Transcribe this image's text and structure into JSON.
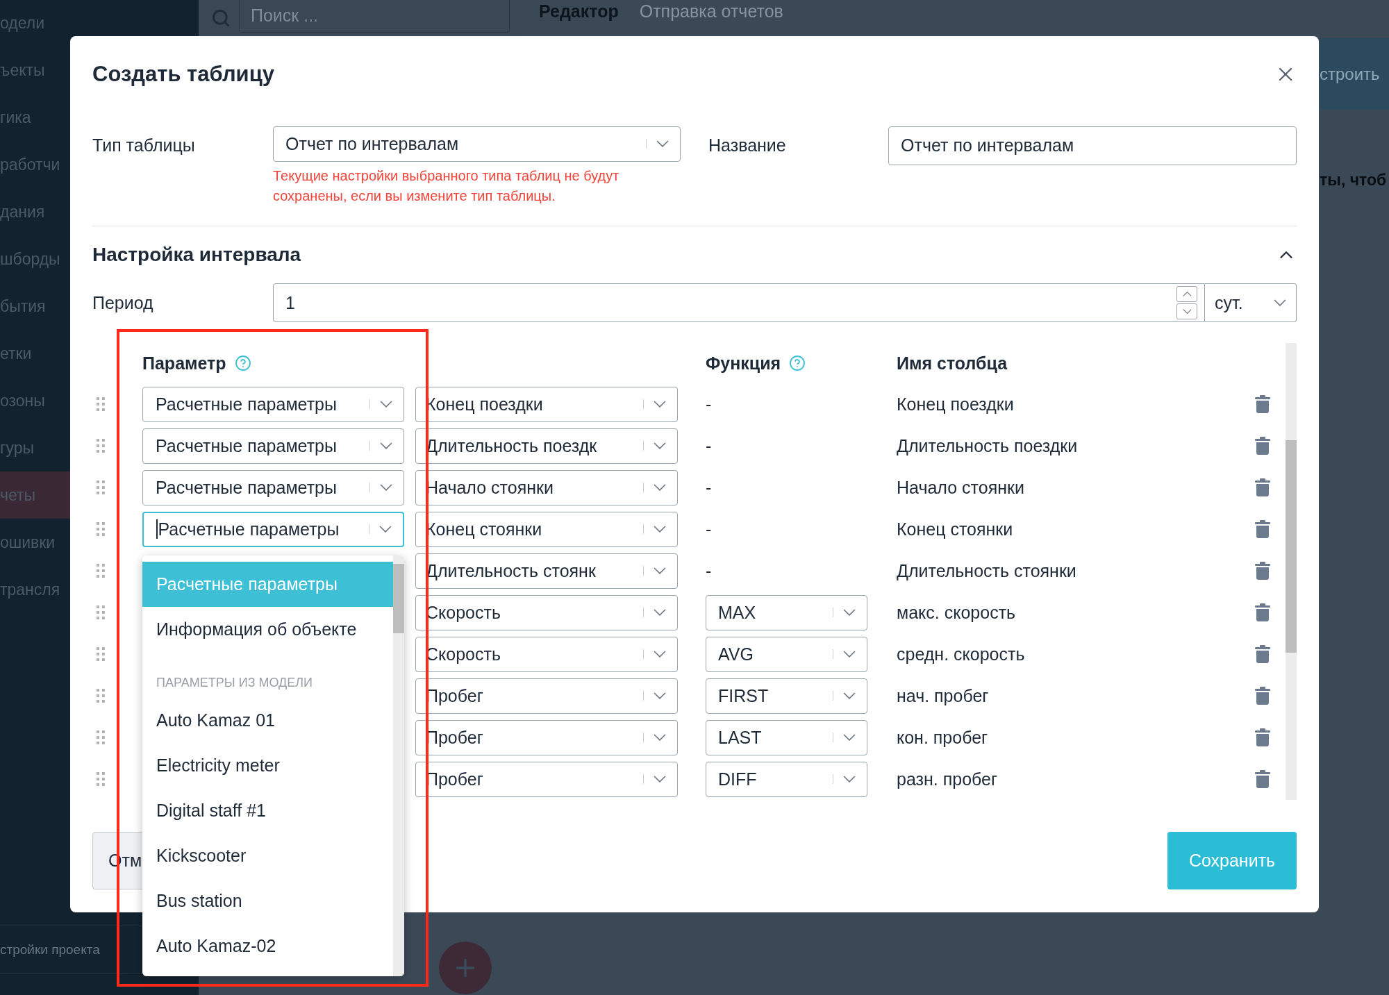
{
  "background": {
    "sidebar": {
      "items": [
        {
          "label": "одели",
          "selected": false
        },
        {
          "label": "ъекты",
          "selected": false
        },
        {
          "label": "гика",
          "selected": false
        },
        {
          "label": "работчи",
          "selected": false
        },
        {
          "label": "дания",
          "selected": false
        },
        {
          "label": "шборды",
          "selected": false
        },
        {
          "label": "бытия",
          "selected": false
        },
        {
          "label": "етки",
          "selected": false
        },
        {
          "label": "озоны",
          "selected": false
        },
        {
          "label": "гуры",
          "selected": false
        },
        {
          "label": "четы",
          "selected": true
        },
        {
          "label": "ошивки",
          "selected": false
        },
        {
          "label": "трансля",
          "selected": false
        }
      ],
      "footer": "стройки проекта"
    },
    "search": {
      "placeholder": "Поиск ..."
    },
    "tabs": [
      {
        "label": "Редактор",
        "selected": true
      },
      {
        "label": "Отправка отчетов",
        "selected": false
      }
    ],
    "action_button": "строить",
    "hint_text": "ты, чтоб"
  },
  "dialog": {
    "title": "Создать таблицу",
    "type_label": "Тип таблицы",
    "type_value": "Отчет по интервалам",
    "type_warning": "Текущие настройки выбранного типа таблиц не будут сохранены, если вы измените тип таблицы.",
    "name_label": "Название",
    "name_value": "Отчет по интервалам",
    "section": {
      "title": "Настройка интервала",
      "expanded": true
    },
    "period_label": "Период",
    "period_value": "1",
    "period_unit": "сут.",
    "columns": {
      "parameter": "Параметр",
      "function": "Функция",
      "column_name": "Имя столбца"
    },
    "rows": [
      {
        "source": "Расчетные параметры",
        "focused": false,
        "field": "Конец поездки",
        "function": {
          "kind": "dash",
          "value": "-"
        },
        "column_name": "Конец поездки"
      },
      {
        "source": "Расчетные параметры",
        "focused": false,
        "field": "Длительность поездк",
        "function": {
          "kind": "dash",
          "value": "-"
        },
        "column_name": "Длительность поездки"
      },
      {
        "source": "Расчетные параметры",
        "focused": false,
        "field": "Начало стоянки",
        "function": {
          "kind": "dash",
          "value": "-"
        },
        "column_name": "Начало стоянки"
      },
      {
        "source": "Расчетные параметры",
        "focused": true,
        "field": "Конец стоянки",
        "function": {
          "kind": "dash",
          "value": "-"
        },
        "column_name": "Конец стоянки"
      },
      {
        "field": "Длительность стоянк",
        "function": {
          "kind": "dash",
          "value": "-"
        },
        "column_name": "Длительность стоянки"
      },
      {
        "field": "Скорость",
        "function": {
          "kind": "select",
          "value": "MAX"
        },
        "column_name": "макс. скорость"
      },
      {
        "field": "Скорость",
        "function": {
          "kind": "select",
          "value": "AVG"
        },
        "column_name": "средн. скорость"
      },
      {
        "field": "Пробег",
        "function": {
          "kind": "select",
          "value": "FIRST"
        },
        "column_name": "нач. пробег"
      },
      {
        "field": "Пробег",
        "function": {
          "kind": "select",
          "value": "LAST"
        },
        "column_name": "кон. пробег"
      },
      {
        "field": "Пробег",
        "function": {
          "kind": "select",
          "value": "DIFF"
        },
        "column_name": "разн. пробег"
      }
    ],
    "dropdown": {
      "items": [
        {
          "kind": "option",
          "label": "Расчетные параметры",
          "selected": true
        },
        {
          "kind": "option",
          "label": "Информация об объекте",
          "selected": false
        },
        {
          "kind": "group",
          "label": "ПАРАМЕТРЫ ИЗ МОДЕЛИ"
        },
        {
          "kind": "option",
          "label": "Auto Kamaz 01",
          "selected": false
        },
        {
          "kind": "option",
          "label": "Electricity meter",
          "selected": false
        },
        {
          "kind": "option",
          "label": "Digital staff #1",
          "selected": false
        },
        {
          "kind": "option",
          "label": "Kickscooter",
          "selected": false
        },
        {
          "kind": "option",
          "label": "Bus station",
          "selected": false
        },
        {
          "kind": "option",
          "label": "Auto Kamaz-02",
          "selected": false
        }
      ]
    },
    "buttons": {
      "cancel": "Отм",
      "save": "Сохранить"
    }
  }
}
